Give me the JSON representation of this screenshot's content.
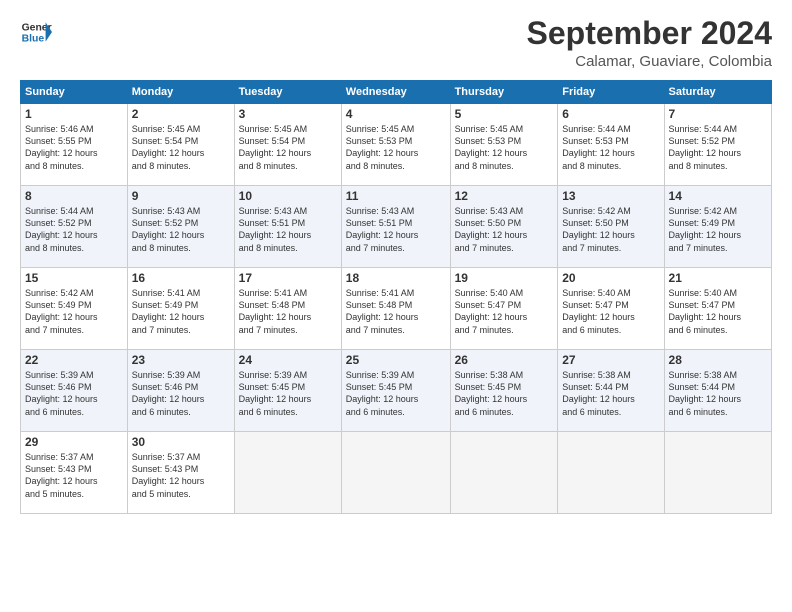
{
  "header": {
    "logo_line1": "General",
    "logo_line2": "Blue",
    "month_title": "September 2024",
    "location": "Calamar, Guaviare, Colombia"
  },
  "weekdays": [
    "Sunday",
    "Monday",
    "Tuesday",
    "Wednesday",
    "Thursday",
    "Friday",
    "Saturday"
  ],
  "weeks": [
    [
      {
        "day": "1",
        "lines": [
          "Sunrise: 5:46 AM",
          "Sunset: 5:55 PM",
          "Daylight: 12 hours",
          "and 8 minutes."
        ]
      },
      {
        "day": "2",
        "lines": [
          "Sunrise: 5:45 AM",
          "Sunset: 5:54 PM",
          "Daylight: 12 hours",
          "and 8 minutes."
        ]
      },
      {
        "day": "3",
        "lines": [
          "Sunrise: 5:45 AM",
          "Sunset: 5:54 PM",
          "Daylight: 12 hours",
          "and 8 minutes."
        ]
      },
      {
        "day": "4",
        "lines": [
          "Sunrise: 5:45 AM",
          "Sunset: 5:53 PM",
          "Daylight: 12 hours",
          "and 8 minutes."
        ]
      },
      {
        "day": "5",
        "lines": [
          "Sunrise: 5:45 AM",
          "Sunset: 5:53 PM",
          "Daylight: 12 hours",
          "and 8 minutes."
        ]
      },
      {
        "day": "6",
        "lines": [
          "Sunrise: 5:44 AM",
          "Sunset: 5:53 PM",
          "Daylight: 12 hours",
          "and 8 minutes."
        ]
      },
      {
        "day": "7",
        "lines": [
          "Sunrise: 5:44 AM",
          "Sunset: 5:52 PM",
          "Daylight: 12 hours",
          "and 8 minutes."
        ]
      }
    ],
    [
      {
        "day": "8",
        "lines": [
          "Sunrise: 5:44 AM",
          "Sunset: 5:52 PM",
          "Daylight: 12 hours",
          "and 8 minutes."
        ]
      },
      {
        "day": "9",
        "lines": [
          "Sunrise: 5:43 AM",
          "Sunset: 5:52 PM",
          "Daylight: 12 hours",
          "and 8 minutes."
        ]
      },
      {
        "day": "10",
        "lines": [
          "Sunrise: 5:43 AM",
          "Sunset: 5:51 PM",
          "Daylight: 12 hours",
          "and 8 minutes."
        ]
      },
      {
        "day": "11",
        "lines": [
          "Sunrise: 5:43 AM",
          "Sunset: 5:51 PM",
          "Daylight: 12 hours",
          "and 7 minutes."
        ]
      },
      {
        "day": "12",
        "lines": [
          "Sunrise: 5:43 AM",
          "Sunset: 5:50 PM",
          "Daylight: 12 hours",
          "and 7 minutes."
        ]
      },
      {
        "day": "13",
        "lines": [
          "Sunrise: 5:42 AM",
          "Sunset: 5:50 PM",
          "Daylight: 12 hours",
          "and 7 minutes."
        ]
      },
      {
        "day": "14",
        "lines": [
          "Sunrise: 5:42 AM",
          "Sunset: 5:49 PM",
          "Daylight: 12 hours",
          "and 7 minutes."
        ]
      }
    ],
    [
      {
        "day": "15",
        "lines": [
          "Sunrise: 5:42 AM",
          "Sunset: 5:49 PM",
          "Daylight: 12 hours",
          "and 7 minutes."
        ]
      },
      {
        "day": "16",
        "lines": [
          "Sunrise: 5:41 AM",
          "Sunset: 5:49 PM",
          "Daylight: 12 hours",
          "and 7 minutes."
        ]
      },
      {
        "day": "17",
        "lines": [
          "Sunrise: 5:41 AM",
          "Sunset: 5:48 PM",
          "Daylight: 12 hours",
          "and 7 minutes."
        ]
      },
      {
        "day": "18",
        "lines": [
          "Sunrise: 5:41 AM",
          "Sunset: 5:48 PM",
          "Daylight: 12 hours",
          "and 7 minutes."
        ]
      },
      {
        "day": "19",
        "lines": [
          "Sunrise: 5:40 AM",
          "Sunset: 5:47 PM",
          "Daylight: 12 hours",
          "and 7 minutes."
        ]
      },
      {
        "day": "20",
        "lines": [
          "Sunrise: 5:40 AM",
          "Sunset: 5:47 PM",
          "Daylight: 12 hours",
          "and 6 minutes."
        ]
      },
      {
        "day": "21",
        "lines": [
          "Sunrise: 5:40 AM",
          "Sunset: 5:47 PM",
          "Daylight: 12 hours",
          "and 6 minutes."
        ]
      }
    ],
    [
      {
        "day": "22",
        "lines": [
          "Sunrise: 5:39 AM",
          "Sunset: 5:46 PM",
          "Daylight: 12 hours",
          "and 6 minutes."
        ]
      },
      {
        "day": "23",
        "lines": [
          "Sunrise: 5:39 AM",
          "Sunset: 5:46 PM",
          "Daylight: 12 hours",
          "and 6 minutes."
        ]
      },
      {
        "day": "24",
        "lines": [
          "Sunrise: 5:39 AM",
          "Sunset: 5:45 PM",
          "Daylight: 12 hours",
          "and 6 minutes."
        ]
      },
      {
        "day": "25",
        "lines": [
          "Sunrise: 5:39 AM",
          "Sunset: 5:45 PM",
          "Daylight: 12 hours",
          "and 6 minutes."
        ]
      },
      {
        "day": "26",
        "lines": [
          "Sunrise: 5:38 AM",
          "Sunset: 5:45 PM",
          "Daylight: 12 hours",
          "and 6 minutes."
        ]
      },
      {
        "day": "27",
        "lines": [
          "Sunrise: 5:38 AM",
          "Sunset: 5:44 PM",
          "Daylight: 12 hours",
          "and 6 minutes."
        ]
      },
      {
        "day": "28",
        "lines": [
          "Sunrise: 5:38 AM",
          "Sunset: 5:44 PM",
          "Daylight: 12 hours",
          "and 6 minutes."
        ]
      }
    ],
    [
      {
        "day": "29",
        "lines": [
          "Sunrise: 5:37 AM",
          "Sunset: 5:43 PM",
          "Daylight: 12 hours",
          "and 5 minutes."
        ]
      },
      {
        "day": "30",
        "lines": [
          "Sunrise: 5:37 AM",
          "Sunset: 5:43 PM",
          "Daylight: 12 hours",
          "and 5 minutes."
        ]
      },
      {
        "day": "",
        "lines": []
      },
      {
        "day": "",
        "lines": []
      },
      {
        "day": "",
        "lines": []
      },
      {
        "day": "",
        "lines": []
      },
      {
        "day": "",
        "lines": []
      }
    ]
  ]
}
